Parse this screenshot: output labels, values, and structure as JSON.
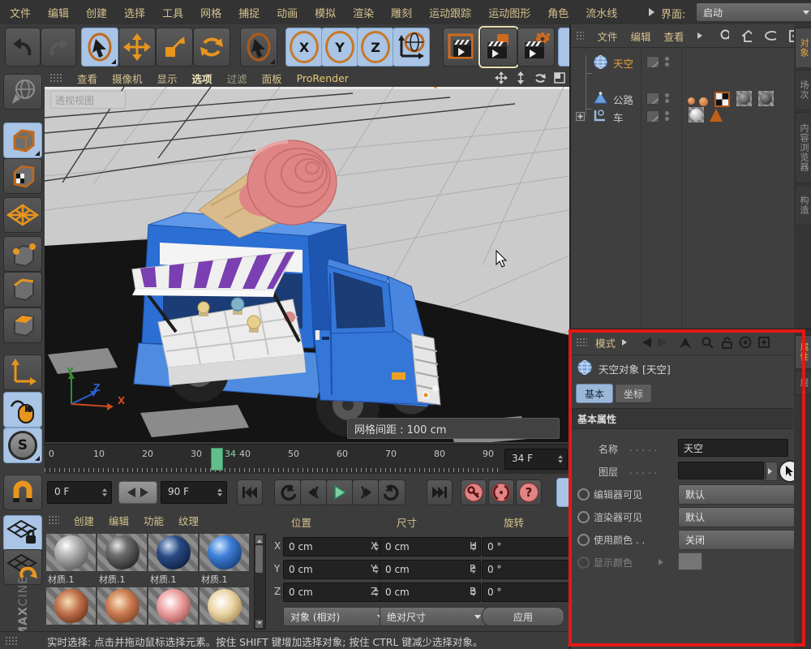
{
  "menu_bar": {
    "items": [
      "文件",
      "编辑",
      "创建",
      "选择",
      "工具",
      "网格",
      "捕捉",
      "动画",
      "模拟",
      "渲染",
      "雕刻",
      "运动跟踪",
      "运动图形",
      "角色",
      "流水线"
    ],
    "interface_label": "界面:",
    "interface_value": "启动"
  },
  "toolbar": {
    "x": "X",
    "y": "Y",
    "z": "Z"
  },
  "sidebar": {
    "snap_letter": "S",
    "logo_line1": "MAX",
    "logo_line2": "CINE"
  },
  "viewport": {
    "menu": [
      "查看",
      "摄像机",
      "显示",
      "选项",
      "过滤",
      "面板",
      "ProRender"
    ],
    "view_label": "透视视图",
    "grid_spacing": "网格间距 : 100 cm",
    "axis_x": "X",
    "axis_y": "Y",
    "axis_z": "Z"
  },
  "object_manager": {
    "menu": [
      "文件",
      "编辑",
      "查看"
    ],
    "objects": [
      "天空",
      "公路",
      "车"
    ],
    "side_tabs": [
      "对象",
      "场次",
      "内容浏览器",
      "构造"
    ]
  },
  "attributes": {
    "mode_label": "模式",
    "title": "天空对象 [天空]",
    "tab_basic": "基本",
    "tab_coord": "坐标",
    "section": "基本属性",
    "name_label": "名称",
    "name_dots": ". . . . .",
    "name_value": "天空",
    "layer_label": "图层",
    "layer_dots": ". . . . .",
    "editor_label": "编辑器可见",
    "editor_value": "默认",
    "renderer_label": "渲染器可见",
    "renderer_value": "默认",
    "usecolor_label": "使用颜色 . .",
    "usecolor_value": "关闭",
    "displaycolor_label": "显示颜色",
    "side_tab_attr": "属性",
    "side_tab_layer": "层"
  },
  "timeline": {
    "ticks": [
      "0",
      "10",
      "20",
      "30",
      "40",
      "50",
      "60",
      "70",
      "80",
      "90"
    ],
    "playhead_label": "34",
    "frame_field": "34 F",
    "start_field": "0 F",
    "end_field": "90 F",
    "question": "?"
  },
  "materials": {
    "menu": [
      "创建",
      "编辑",
      "功能",
      "纹理"
    ],
    "labels": [
      "材质.1",
      "材质.1",
      "材质.1",
      "材质.1"
    ]
  },
  "coordinates": {
    "h_pos": "位置",
    "h_size": "尺寸",
    "h_rot": "旋转",
    "px": "X",
    "py": "Y",
    "pz": "Z",
    "sx": "X",
    "sy": "Y",
    "sz": "Z",
    "rh": "H",
    "rp": "P",
    "rb": "B",
    "pos_values": [
      "0 cm",
      "0 cm",
      "0 cm"
    ],
    "size_values": [
      "0 cm",
      "0 cm",
      "0 cm"
    ],
    "rot_values": [
      "0 °",
      "0 °",
      "0 °"
    ],
    "mode_object": "对象 (相对)",
    "mode_size": "绝对尺寸",
    "apply": "应用"
  },
  "status_bar": {
    "text": "实时选择: 点击并拖动鼠标选择元素。按住 SHIFT 键增加选择对象; 按住 CTRL 键减少选择对象。"
  },
  "colors": {
    "accent_orange": "#e8941a",
    "selection_blue": "#a9c4e4",
    "annotation_red": "#e61717",
    "playhead_green": "#5fbe8b",
    "object_selected": "#e8a23c"
  }
}
